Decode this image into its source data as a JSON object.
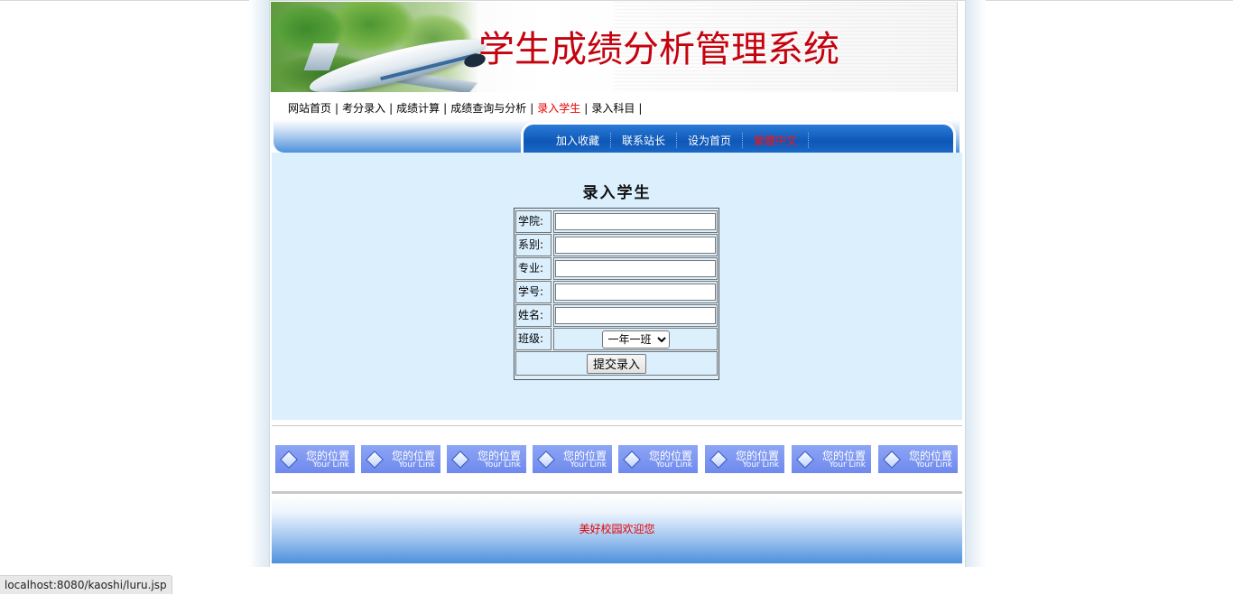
{
  "banner": {
    "title": "学生成绩分析管理系统"
  },
  "nav": {
    "items": [
      {
        "label": "网站首页"
      },
      {
        "label": "考分录入"
      },
      {
        "label": "成绩计算"
      },
      {
        "label": "成绩查询与分析"
      },
      {
        "label": "录入学生",
        "active": true
      },
      {
        "label": "录入科目"
      }
    ],
    "separator": "|",
    "sub_links": [
      {
        "label": "加入收藏"
      },
      {
        "label": "联系站长"
      },
      {
        "label": "设为首页"
      },
      {
        "label": "繁體中文",
        "color": "#ff1010"
      }
    ]
  },
  "form": {
    "title": "录入学生",
    "fields": [
      {
        "label": "学院:",
        "value": ""
      },
      {
        "label": "系别:",
        "value": ""
      },
      {
        "label": "专业:",
        "value": ""
      },
      {
        "label": "学号:",
        "value": ""
      },
      {
        "label": "姓名:",
        "value": ""
      }
    ],
    "class_label": "班级:",
    "class_selected": "一年一班",
    "submit_label": "提交录入"
  },
  "links": {
    "items": [
      {
        "title": "您的位置",
        "sub": "Your Link"
      },
      {
        "title": "您的位置",
        "sub": "Your Link"
      },
      {
        "title": "您的位置",
        "sub": "Your Link"
      },
      {
        "title": "您的位置",
        "sub": "Your Link"
      },
      {
        "title": "您的位置",
        "sub": "Your Link"
      },
      {
        "title": "您的位置",
        "sub": "Your Link"
      },
      {
        "title": "您的位置",
        "sub": "Your Link"
      },
      {
        "title": "您的位置",
        "sub": "Your Link"
      }
    ]
  },
  "footer": {
    "message": "美好校园欢迎您"
  },
  "statusbar": {
    "url": "localhost:8080/kaoshi/luru.jsp"
  },
  "colors": {
    "accent_red": "#e60000",
    "nav_blue": "#0e57b6",
    "content_bg": "#dbeffd"
  }
}
